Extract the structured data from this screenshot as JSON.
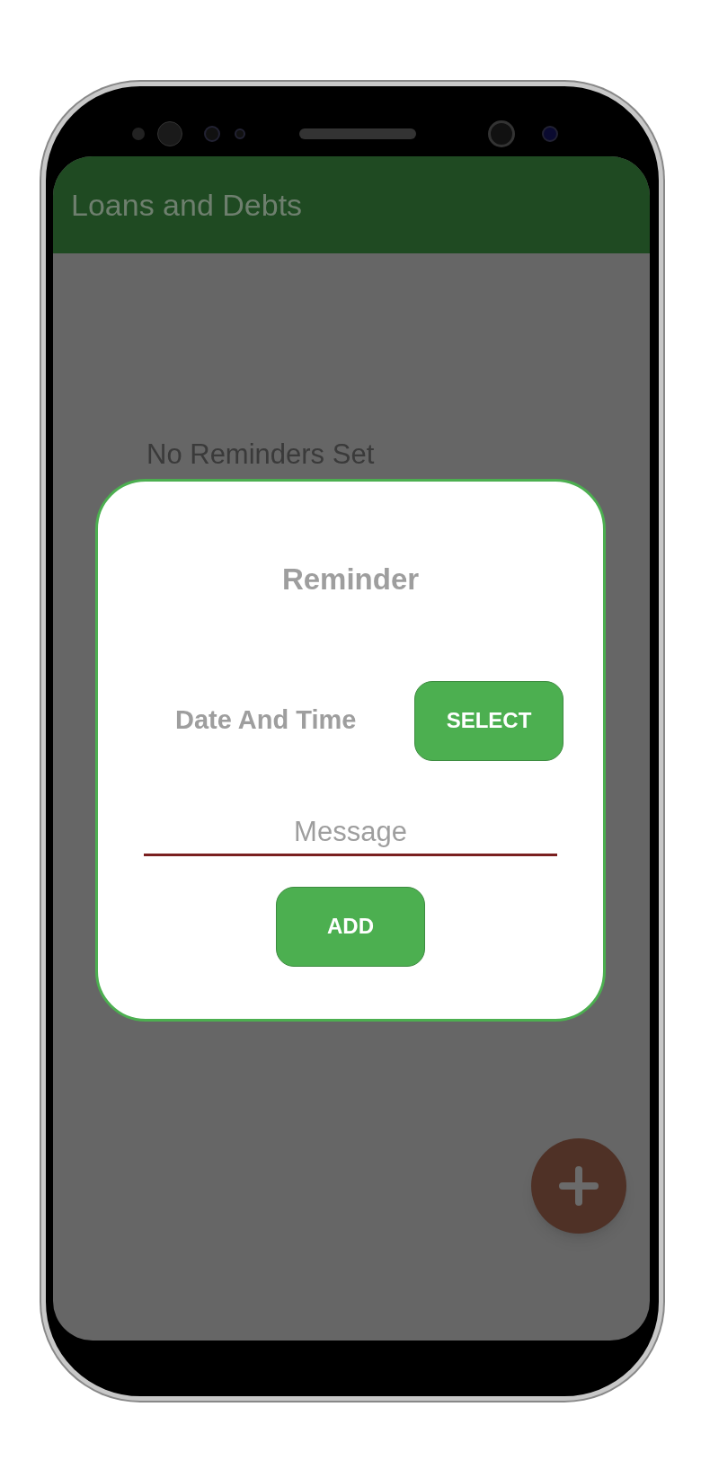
{
  "app_bar": {
    "title": "Loans and Debts"
  },
  "empty_state": "No Reminders Set",
  "dialog": {
    "title": "Reminder",
    "date_label": "Date And Time",
    "select_button": "SELECT",
    "message": {
      "placeholder": "Message"
    },
    "add_button": "ADD"
  }
}
